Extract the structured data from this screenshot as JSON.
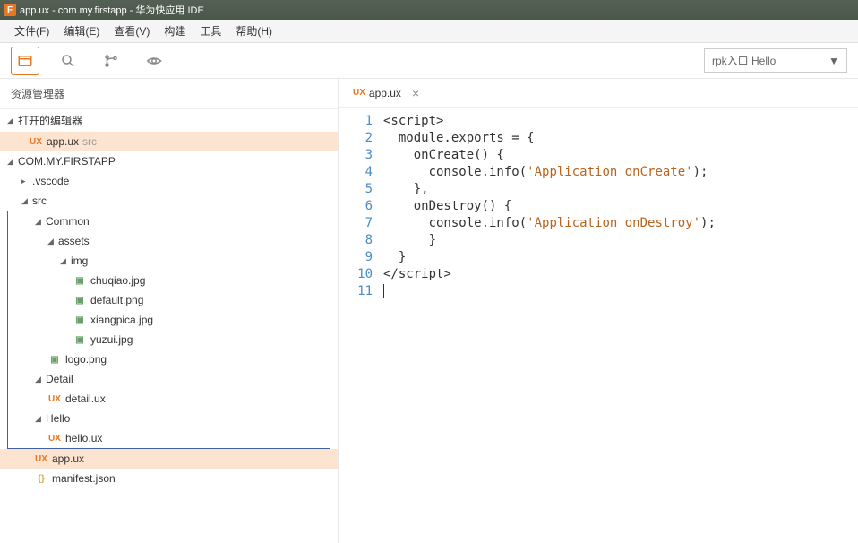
{
  "titlebar": {
    "icon": "F",
    "text": "app.ux - com.my.firstapp - 华为快应用 IDE"
  },
  "menubar": {
    "file": "文件(F)",
    "edit": "编辑(E)",
    "view": "查看(V)",
    "build": "构建",
    "tools": "工具",
    "help": "帮助(H)"
  },
  "toolbar": {
    "dropdown": "rpk入口 Hello"
  },
  "sidebar": {
    "header": "资源管理器",
    "openEditors": "打开的编辑器",
    "openFile": {
      "name": "app.ux",
      "dir": "src"
    },
    "projectName": "COM.MY.FIRSTAPP",
    "tree": {
      "vscode": ".vscode",
      "src": "src",
      "common": "Common",
      "assets": "assets",
      "img": "img",
      "files": {
        "chuqiao": "chuqiao.jpg",
        "default": "default.png",
        "xiangpica": "xiangpica.jpg",
        "yuzui": "yuzui.jpg",
        "logo": "logo.png"
      },
      "detail": "Detail",
      "detailux": "detail.ux",
      "hello": "Hello",
      "helloux": "hello.ux",
      "appux": "app.ux",
      "manifest": "manifest.json"
    }
  },
  "editor": {
    "tabName": "app.ux",
    "lines": {
      "l1": "<script>",
      "l2": "  module.exports = {",
      "l3": "    onCreate() {",
      "l4a": "      console.info(",
      "l4s": "'Application onCreate'",
      "l4b": ");",
      "l5": "    },",
      "l6": "    onDestroy() {",
      "l7a": "      console.info(",
      "l7s": "'Application onDestroy'",
      "l7b": ");",
      "l8": "      }",
      "l9": "  }",
      "l10": "</script>"
    },
    "lineNumbers": [
      "1",
      "2",
      "3",
      "4",
      "5",
      "6",
      "7",
      "8",
      "9",
      "10",
      "11"
    ]
  }
}
